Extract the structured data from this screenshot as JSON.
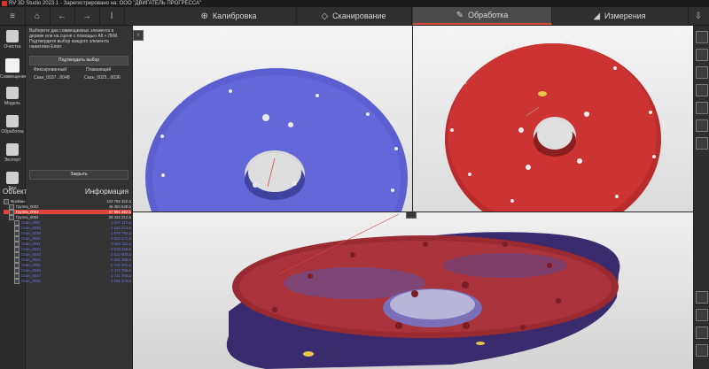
{
  "window": {
    "title": "RV 3D Studio 2023.1 - Зарегистрировано на: ООО \"ДВИГАТЕЛЬ ПРОГРЕССА\""
  },
  "tabs": [
    {
      "label": "Калибровка",
      "icon": "target-icon"
    },
    {
      "label": "Сканирование",
      "icon": "cube-icon"
    },
    {
      "label": "Обработка",
      "icon": "pencil-icon",
      "active": true
    },
    {
      "label": "Измерения",
      "icon": "ruler-icon"
    }
  ],
  "tools": [
    {
      "label": "Очистка"
    },
    {
      "label": "Совмещение",
      "active": true
    },
    {
      "label": "Модель"
    },
    {
      "label": "Обработка"
    },
    {
      "label": "Экспорт"
    },
    {
      "label": "Вид"
    }
  ],
  "panel": {
    "instruction": "Выберите два совмещаемых элемента в дереве или на сцене с помощью Alt + ЛКМ. Подтвердите выбор каждого элемента нажатием Enter.",
    "confirm_label": "Подтвердить выбор",
    "fixed_label": "Фиксированный",
    "floating_label": "Плавающий",
    "fixed_value": "Скан_0037...0048",
    "floating_value": "Скан_0025...0036",
    "close_label": "Закрыть"
  },
  "tree": {
    "col_object": "Объект",
    "col_info": "Информация",
    "rows": [
      {
        "name": "Фреймы",
        "value": "123 789 322 Δ",
        "indent": 0,
        "style": "normal"
      },
      {
        "name": "Группа_0002",
        "value": "46 350 648 Δ",
        "indent": 1,
        "style": "normal"
      },
      {
        "name": "Группа_0003",
        "value": "47 891 462 Δ",
        "indent": 1,
        "style": "highlight"
      },
      {
        "name": "Группа_0004",
        "value": "29 434 212 Δ",
        "indent": 1,
        "style": "normal"
      },
      {
        "name": "Скан_0037",
        "value": "1 647 117 Δ",
        "indent": 2,
        "style": "blue"
      },
      {
        "name": "Скан_0038",
        "value": "2 154 213 Δ",
        "indent": 2,
        "style": "blue"
      },
      {
        "name": "Скан_0039",
        "value": "1 878 793 Δ",
        "indent": 2,
        "style": "blue"
      },
      {
        "name": "Скан_0040",
        "value": "2 042 571 Δ",
        "indent": 2,
        "style": "blue"
      },
      {
        "name": "Скан_0041",
        "value": "2 654 211 Δ",
        "indent": 2,
        "style": "blue"
      },
      {
        "name": "Скан_0042",
        "value": "2 578 349 Δ",
        "indent": 2,
        "style": "blue"
      },
      {
        "name": "Скан_0043",
        "value": "2 512 800 Δ",
        "indent": 2,
        "style": "blue"
      },
      {
        "name": "Скан_0044",
        "value": "2 625 389 Δ",
        "indent": 2,
        "style": "blue"
      },
      {
        "name": "Скан_0045",
        "value": "2 316 001 Δ",
        "indent": 2,
        "style": "blue"
      },
      {
        "name": "Скан_0046",
        "value": "2 473 796 Δ",
        "indent": 2,
        "style": "blue"
      },
      {
        "name": "Скан_0047",
        "value": "1 721 706 Δ",
        "indent": 2,
        "style": "blue"
      },
      {
        "name": "Скан_0048",
        "value": "1 646 476 Δ",
        "indent": 2,
        "style": "blue"
      }
    ]
  },
  "colors": {
    "accent": "#e04a3f",
    "blue_scan": "#5a5fcf",
    "red_scan": "#c8302f",
    "highlight_row": "#e0433a"
  }
}
